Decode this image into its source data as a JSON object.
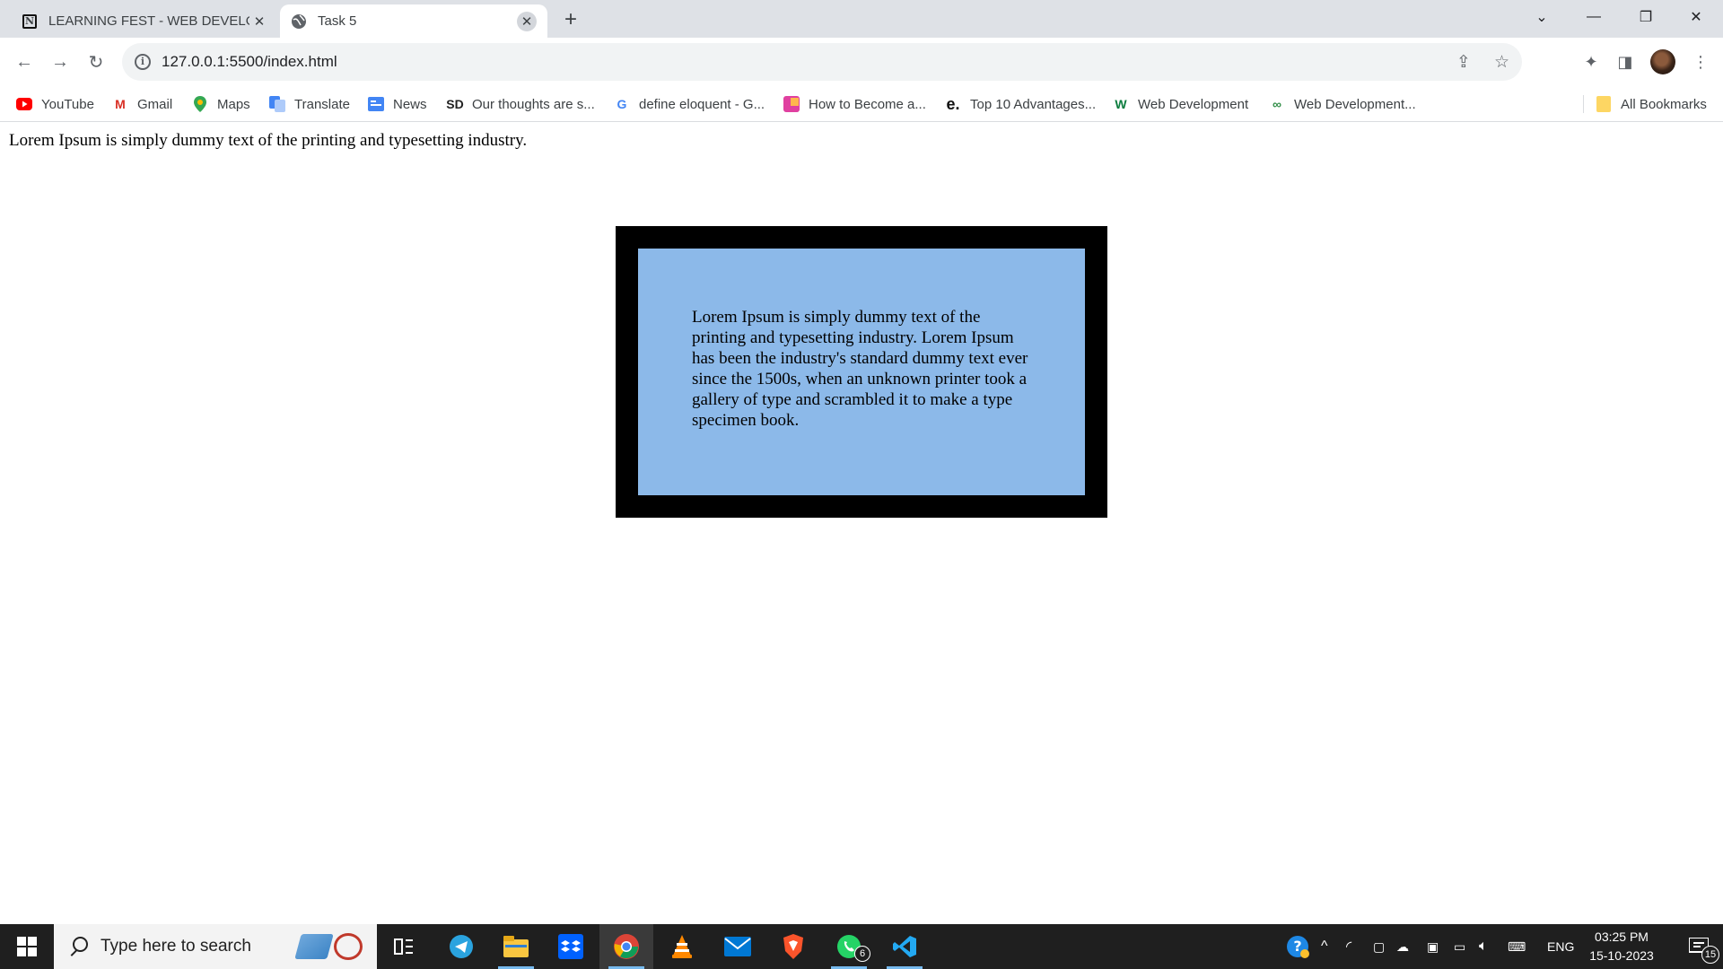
{
  "browser": {
    "tabs": [
      {
        "title": "LEARNING FEST - WEB DEVELOP",
        "favicon": "notion-icon",
        "active": false
      },
      {
        "title": "Task 5",
        "favicon": "globe-icon",
        "active": true
      }
    ],
    "address": "127.0.0.1:5500/index.html",
    "bookmarks": [
      {
        "label": "YouTube",
        "icon": "youtube-icon"
      },
      {
        "label": "Gmail",
        "icon": "gmail-icon"
      },
      {
        "label": "Maps",
        "icon": "maps-icon"
      },
      {
        "label": "Translate",
        "icon": "translate-icon"
      },
      {
        "label": "News",
        "icon": "news-icon"
      },
      {
        "label": "Our thoughts are s...",
        "icon": "sd-icon"
      },
      {
        "label": "define eloquent - G...",
        "icon": "google-icon"
      },
      {
        "label": "How to Become a...",
        "icon": "bookmark-icon"
      },
      {
        "label": "Top 10 Advantages...",
        "icon": "e-icon"
      },
      {
        "label": "Web Development",
        "icon": "w-icon"
      },
      {
        "label": "Web Development...",
        "icon": "link-icon"
      }
    ],
    "all_bookmarks": "All Bookmarks"
  },
  "page": {
    "top_line": "Lorem Ipsum is simply dummy text of the printing and typesetting industry.",
    "box_text": "Lorem Ipsum is simply dummy text of the printing and typesetting industry. Lorem Ipsum has been the industry's standard dummy text ever since the 1500s, when an unknown printer took a gallery of type and scrambled it to make a type specimen book.",
    "box_fill": "#8cb9e9",
    "box_border": "#000000"
  },
  "taskbar": {
    "search_placeholder": "Type here to search",
    "whatsapp_badge": "6",
    "language": "ENG",
    "time": "03:25 PM",
    "date": "15-10-2023",
    "notification_count": "15"
  }
}
